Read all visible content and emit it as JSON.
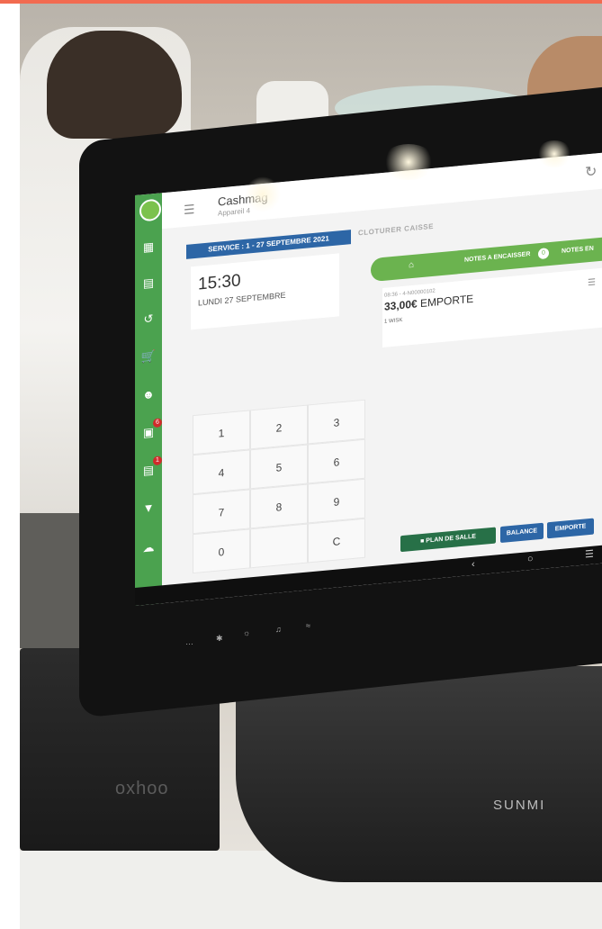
{
  "app": {
    "title": "Cashmag",
    "subtitle": "Appareil 4"
  },
  "toolbar": {
    "service_label": "SERVICE : 1 - 27 SEPTEMBRE 2021",
    "cloturer_label": "CLOTURER CAISSE"
  },
  "clock": {
    "time": "15:30",
    "date": "LUNDI 27 SEPTEMBRE"
  },
  "tabs": {
    "notes_a_encaisser": "NOTES A ENCAISSER",
    "notes_a_encaisser_count": "0",
    "notes_en": "NOTES EN"
  },
  "order": {
    "meta": "08:36 - 4-N00000102",
    "amount": "33,00€",
    "mode": "EMPORTE",
    "item": "1 WISK"
  },
  "keypad": {
    "keys": [
      "1",
      "2",
      "3",
      "4",
      "5",
      "6",
      "7",
      "8",
      "9",
      "0",
      "",
      "C"
    ]
  },
  "actions": {
    "plan_de_salle": "PLAN DE SALLE",
    "balance": "BALANCE",
    "emporte": "EMPORTE"
  },
  "nav": {
    "badge_calendar": "6",
    "badge_notes": "1"
  },
  "brands": {
    "printer": "oxhoo",
    "stand": "SUNMI"
  },
  "colors": {
    "sidebar_green": "#4ba24f",
    "service_blue": "#2d66a6",
    "tab_green": "#6bb34f",
    "plan_green": "#277047",
    "badge_red": "#d02b2b"
  }
}
